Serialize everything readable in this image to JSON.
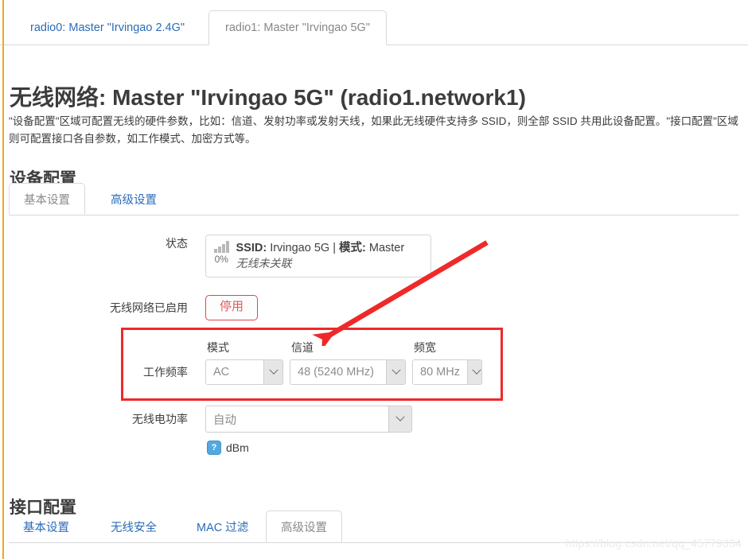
{
  "radio_tabs": [
    {
      "label": "radio0: Master \"Irvingao 2.4G\"",
      "active": false
    },
    {
      "label": "radio1: Master \"Irvingao 5G\"",
      "active": true
    }
  ],
  "page": {
    "title": "无线网络: Master \"Irvingao 5G\" (radio1.network1)",
    "description": "\"设备配置\"区域可配置无线的硬件参数，比如：信道、发射功率或发射天线，如果此无线硬件支持多 SSID，则全部 SSID 共用此设备配置。\"接口配置\"区域则可配置接口各自参数，如工作模式、加密方式等。"
  },
  "device_section": {
    "title": "设备配置",
    "tabs": [
      {
        "label": "基本设置",
        "active": true
      },
      {
        "label": "高级设置",
        "active": false
      }
    ],
    "status": {
      "label": "状态",
      "signal_percent": "0%",
      "ssid_key": "SSID:",
      "ssid_value": "Irvingao 5G",
      "separator": "|",
      "mode_key": "模式:",
      "mode_value": "Master",
      "detail": "无线未关联"
    },
    "enable": {
      "label": "无线网络已启用",
      "button": "停用"
    },
    "frequency": {
      "label": "工作频率",
      "mode": {
        "caption": "模式",
        "value": "AC"
      },
      "channel": {
        "caption": "信道",
        "value": "48 (5240 MHz)"
      },
      "width": {
        "caption": "频宽",
        "value": "80 MHz"
      }
    },
    "power": {
      "label": "无线电功率",
      "value": "自动",
      "unit": "dBm",
      "help_glyph": "?"
    }
  },
  "interface_section": {
    "title": "接口配置",
    "tabs": [
      {
        "label": "基本设置",
        "active": false
      },
      {
        "label": "无线安全",
        "active": false
      },
      {
        "label": "MAC 过滤",
        "active": false
      },
      {
        "label": "高级设置",
        "active": true
      }
    ]
  },
  "annotations": {
    "highlight_color": "#ef2929",
    "arrow_color": "#ef2929"
  },
  "watermark": "https://blog.csdn.net/qq_45779334"
}
